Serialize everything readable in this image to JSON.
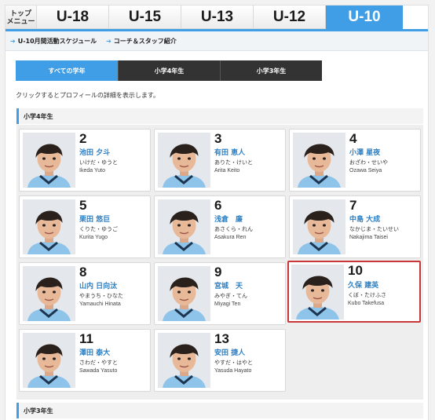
{
  "tabs": [
    {
      "label": "トップ\nメニュー",
      "kind": "menu"
    },
    {
      "label": "U-18",
      "kind": "age"
    },
    {
      "label": "U-15",
      "kind": "age"
    },
    {
      "label": "U-13",
      "kind": "age"
    },
    {
      "label": "U-12",
      "kind": "age"
    },
    {
      "label": "U-10",
      "kind": "age",
      "active": true
    }
  ],
  "subnav": [
    {
      "label": "U-10月間活動スケジュール"
    },
    {
      "label": "コーチ＆スタッフ紹介"
    }
  ],
  "filters": [
    {
      "label": "すべての学年",
      "active": true
    },
    {
      "label": "小学4年生"
    },
    {
      "label": "小学3年生"
    }
  ],
  "hint": "クリックするとプロフィールの詳細を表示します。",
  "sections": [
    {
      "title": "小学4年生"
    },
    {
      "title": "小学3年生"
    }
  ],
  "players": [
    {
      "number": "2",
      "name": "池田 夕斗",
      "kana": "いけだ・ゆうと",
      "romaji": "Ikeda Yuto"
    },
    {
      "number": "3",
      "name": "有田 恵人",
      "kana": "ありた・けいと",
      "romaji": "Arita Keito"
    },
    {
      "number": "4",
      "name": "小澤 星夜",
      "kana": "おざわ・せいや",
      "romaji": "Ozawa Seiya"
    },
    {
      "number": "5",
      "name": "栗田 悠巨",
      "kana": "くりた・ゆうご",
      "romaji": "Kurita Yugo"
    },
    {
      "number": "6",
      "name": "浅倉　廉",
      "kana": "あさくら・れん",
      "romaji": "Asakura Ren"
    },
    {
      "number": "7",
      "name": "中島 大成",
      "kana": "なかじま・たいせい",
      "romaji": "Nakajima Taisei"
    },
    {
      "number": "8",
      "name": "山内 日向汰",
      "kana": "やまうち・ひなた",
      "romaji": "Yamauchi Hinata"
    },
    {
      "number": "9",
      "name": "宮城　天",
      "kana": "みやぎ・てん",
      "romaji": "Miyagi Ten"
    },
    {
      "number": "10",
      "name": "久保 建英",
      "kana": "くぼ・たけふさ",
      "romaji": "Kubo Takefusa",
      "selected": true
    },
    {
      "number": "11",
      "name": "澤田 泰大",
      "kana": "さわだ・やすと",
      "romaji": "Sawada Yasuto"
    },
    {
      "number": "13",
      "name": "安田 捷人",
      "kana": "やすだ・はやと",
      "romaji": "Yasuda Hayato"
    }
  ],
  "colors": {
    "accent": "#3f9ee6",
    "name_link": "#2e7fc2",
    "selected_border": "#c8383a",
    "filter_dark": "#333333"
  },
  "icons": {
    "subnav_arrow": "arrow-right-icon"
  }
}
